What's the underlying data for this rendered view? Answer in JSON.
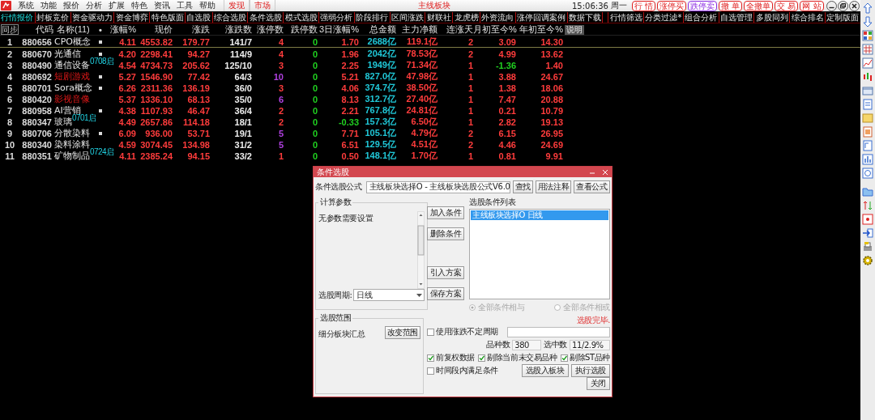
{
  "menu_bar": {
    "items": [
      "系统",
      "功能",
      "报价",
      "分析",
      "扩展",
      "特色",
      "资讯",
      "工具",
      "帮助"
    ],
    "links": [
      "发现",
      "市场"
    ],
    "title": "主线板块",
    "clock": "15:06:36",
    "weekday": "周一",
    "trade_buttons": [
      {
        "label": "行 情",
        "color": "#e02020"
      },
      {
        "label": "涨停买",
        "color": "#e02020"
      },
      {
        "label": "跌停卖",
        "color": "#8a2be2"
      },
      {
        "label": "撤 单",
        "color": "#e02020"
      },
      {
        "label": "全撤单",
        "color": "#e02020"
      },
      {
        "label": "交 易",
        "color": "#e02020"
      },
      {
        "label": "网 站",
        "color": "#e02020"
      }
    ]
  },
  "tabs": [
    {
      "label": "行情报价",
      "selected": true
    },
    {
      "label": "封板竞价",
      "selected": false
    },
    {
      "label": "资金驱动力",
      "selected": false
    },
    {
      "label": "资金博弈",
      "selected": false
    },
    {
      "label": "特色版面",
      "selected": false
    },
    {
      "label": "自选股",
      "selected": false
    },
    {
      "label": "综合选股",
      "selected": false
    },
    {
      "label": "条件选股",
      "selected": false
    },
    {
      "label": "模式选股",
      "selected": false
    },
    {
      "label": "强弱分析",
      "selected": false
    },
    {
      "label": "阶段排行",
      "selected": false
    },
    {
      "label": "区间涨跌",
      "selected": false
    },
    {
      "label": "财联社",
      "selected": false
    },
    {
      "label": "龙虎榜",
      "selected": false
    },
    {
      "label": "外资流向",
      "selected": false
    },
    {
      "label": "涨停回调案例",
      "selected": false
    },
    {
      "label": "数据下载",
      "selected": false
    }
  ],
  "tabs_right": [
    "行情筛选",
    "分类过滤*",
    "组合分析",
    "自选管理",
    "多股同列",
    "综合排名",
    "定制版面"
  ],
  "table": {
    "sync_button": "同步",
    "note_button": "说明",
    "columns": [
      "代码",
      "名称(11)",
      "•",
      "涨幅%",
      "现价",
      "涨跌",
      "涨跌数",
      "涨停数",
      "跌停数",
      "3日涨幅%",
      "总金额",
      "主力净额",
      "连涨天",
      "月初至今%",
      "年初至今%"
    ],
    "rows": [
      {
        "no": "1",
        "code": "880656",
        "name": "CPO概念",
        "highlighted": false,
        "marked": true,
        "change_pct": "4.11",
        "price": "4553.82",
        "change": "179.77",
        "up_down": "141/7",
        "limit_up": {
          "text": "4",
          "color": "#ff3c3c"
        },
        "limit_down": "0",
        "three_day": {
          "text": "1.70",
          "color": "#ff3c3c"
        },
        "amount": "2688亿",
        "net": "119.1亿",
        "streak": "2",
        "mtd": {
          "text": "3.09",
          "color": "#ff3c3c"
        },
        "ytd": "14.30",
        "selected": true
      },
      {
        "no": "2",
        "code": "880670",
        "name": "光通信",
        "highlighted": false,
        "marked": true,
        "change_pct": "4.20",
        "price": "2298.41",
        "change": "94.27",
        "up_down": "114/9",
        "limit_up": {
          "text": "4",
          "color": "#ff3c3c"
        },
        "limit_down": "0",
        "three_day": {
          "text": "1.96",
          "color": "#ff3c3c"
        },
        "amount": "2042亿",
        "net": "78.53亿",
        "streak": "2",
        "mtd": {
          "text": "4.99",
          "color": "#ff3c3c"
        },
        "ytd": "13.62",
        "selected": false
      },
      {
        "no": "3",
        "code": "880490",
        "name": "通信设备",
        "tag": "0708启",
        "highlighted": false,
        "marked": false,
        "change_pct": "4.54",
        "price": "4734.73",
        "change": "205.62",
        "up_down": "125/10",
        "limit_up": {
          "text": "3",
          "color": "#ff3c3c"
        },
        "limit_down": "0",
        "three_day": {
          "text": "2.25",
          "color": "#ff3c3c"
        },
        "amount": "1949亿",
        "net": "71.34亿",
        "streak": "1",
        "mtd": {
          "text": "-1.36",
          "color": "#20d020"
        },
        "ytd": "1.40",
        "selected": false
      },
      {
        "no": "4",
        "code": "880692",
        "name": "短剧游戏",
        "highlighted": true,
        "marked": true,
        "change_pct": "5.27",
        "price": "1546.90",
        "change": "77.42",
        "up_down": "64/3",
        "limit_up": {
          "text": "10",
          "color": "#b040e0"
        },
        "limit_down": "0",
        "three_day": {
          "text": "5.21",
          "color": "#ff3c3c"
        },
        "amount": "827.0亿",
        "net": "47.98亿",
        "streak": "1",
        "mtd": {
          "text": "3.88",
          "color": "#ff3c3c"
        },
        "ytd": "24.67",
        "selected": false
      },
      {
        "no": "5",
        "code": "880701",
        "name": "Sora概念",
        "highlighted": false,
        "marked": true,
        "change_pct": "6.26",
        "price": "2311.36",
        "change": "136.19",
        "up_down": "36/0",
        "limit_up": {
          "text": "3",
          "color": "#ff3c3c"
        },
        "limit_down": "0",
        "three_day": {
          "text": "4.06",
          "color": "#ff3c3c"
        },
        "amount": "374.7亿",
        "net": "38.50亿",
        "streak": "1",
        "mtd": {
          "text": "1.38",
          "color": "#ff3c3c"
        },
        "ytd": "18.06",
        "selected": false
      },
      {
        "no": "6",
        "code": "880420",
        "name": "影视音像",
        "highlighted": true,
        "marked": false,
        "change_pct": "5.37",
        "price": "1336.10",
        "change": "68.13",
        "up_down": "35/0",
        "limit_up": {
          "text": "6",
          "color": "#b040e0"
        },
        "limit_down": "0",
        "three_day": {
          "text": "8.13",
          "color": "#ff3c3c"
        },
        "amount": "312.7亿",
        "net": "27.40亿",
        "streak": "1",
        "mtd": {
          "text": "7.47",
          "color": "#ff3c3c"
        },
        "ytd": "20.88",
        "selected": false
      },
      {
        "no": "7",
        "code": "880958",
        "name": "AI营销",
        "highlighted": false,
        "marked": true,
        "change_pct": "4.38",
        "price": "1107.93",
        "change": "46.47",
        "up_down": "36/4",
        "limit_up": {
          "text": "2",
          "color": "#ff3c3c"
        },
        "limit_down": "0",
        "three_day": {
          "text": "2.21",
          "color": "#ff3c3c"
        },
        "amount": "767.8亿",
        "net": "24.81亿",
        "streak": "1",
        "mtd": {
          "text": "0.21",
          "color": "#ff3c3c"
        },
        "ytd": "10.79",
        "selected": false
      },
      {
        "no": "8",
        "code": "880347",
        "name": "玻璃",
        "tag": "0701启",
        "highlighted": false,
        "marked": false,
        "change_pct": "4.49",
        "price": "2657.86",
        "change": "114.18",
        "up_down": "18/1",
        "limit_up": {
          "text": "2",
          "color": "#ff3c3c"
        },
        "limit_down": "0",
        "three_day": {
          "text": "-0.33",
          "color": "#20d020"
        },
        "amount": "157.3亿",
        "net": "6.50亿",
        "streak": "1",
        "mtd": {
          "text": "2.82",
          "color": "#ff3c3c"
        },
        "ytd": "19.13",
        "selected": false
      },
      {
        "no": "9",
        "code": "880706",
        "name": "分散染料",
        "highlighted": false,
        "marked": true,
        "change_pct": "6.09",
        "price": "936.00",
        "change": "53.71",
        "up_down": "19/1",
        "limit_up": {
          "text": "5",
          "color": "#b040e0"
        },
        "limit_down": "0",
        "three_day": {
          "text": "7.71",
          "color": "#ff3c3c"
        },
        "amount": "105.1亿",
        "net": "4.79亿",
        "streak": "2",
        "mtd": {
          "text": "6.15",
          "color": "#ff3c3c"
        },
        "ytd": "26.95",
        "selected": false
      },
      {
        "no": "10",
        "code": "880340",
        "name": "染料涂料",
        "highlighted": false,
        "marked": false,
        "change_pct": "4.59",
        "price": "3074.45",
        "change": "134.98",
        "up_down": "31/2",
        "limit_up": {
          "text": "5",
          "color": "#b040e0"
        },
        "limit_down": "0",
        "three_day": {
          "text": "6.51",
          "color": "#ff3c3c"
        },
        "amount": "129.5亿",
        "net": "4.51亿",
        "streak": "2",
        "mtd": {
          "text": "4.46",
          "color": "#ff3c3c"
        },
        "ytd": "24.69",
        "selected": false
      },
      {
        "no": "11",
        "code": "880351",
        "name": "矿物制品",
        "tag": "0724启",
        "highlighted": false,
        "marked": false,
        "change_pct": "4.11",
        "price": "2385.24",
        "change": "94.15",
        "up_down": "33/2",
        "limit_up": {
          "text": "1",
          "color": "#ff3c3c"
        },
        "limit_down": "0",
        "three_day": {
          "text": "0.50",
          "color": "#ff3c3c"
        },
        "amount": "148.1亿",
        "net": "1.70亿",
        "streak": "1",
        "mtd": {
          "text": "0.81",
          "color": "#ff3c3c"
        },
        "ytd": "9.91",
        "selected": false
      }
    ]
  },
  "dialog": {
    "title": "条件选股",
    "formula_label": "条件选股公式",
    "formula": "主线板块选择O  -  主线板块选股公式V6.0",
    "top_buttons": [
      "查找",
      "用法注释",
      "查看公式"
    ],
    "params_group": "计算参数",
    "params_text": "无参数需要设置",
    "period_label": "选股周期:",
    "period": "日线",
    "scope_group": "选股范围",
    "scope_text": "细分板块汇总",
    "scope_button": "改变范围",
    "action_buttons": [
      "加入条件",
      "删除条件",
      "引入方案",
      "保存方案"
    ],
    "list_label": "选股条件列表",
    "conditions": [
      {
        "label": "主线板块选择O  日线",
        "selected": true
      }
    ],
    "logic": [
      {
        "label": "全部条件相与",
        "selected": true,
        "disabled": true
      },
      {
        "label": "全部条件相或",
        "selected": false,
        "disabled": true
      }
    ],
    "status": "选股完毕.",
    "options": [
      {
        "label": "使用涨跌不定周期",
        "checked": false
      },
      {
        "label": "前复权数据",
        "checked": true
      },
      {
        "label": "剔除当前未交易品种",
        "checked": true
      },
      {
        "label": "剔除ST品种",
        "checked": true
      },
      {
        "label": "时间段内满足条件",
        "checked": false
      }
    ],
    "count_label": "品种数",
    "count": "380",
    "picked_label": "选中数",
    "picked": "11/2.9%",
    "bottom_buttons": [
      "选股入板块",
      "执行选股"
    ],
    "close_button": "关闭"
  }
}
